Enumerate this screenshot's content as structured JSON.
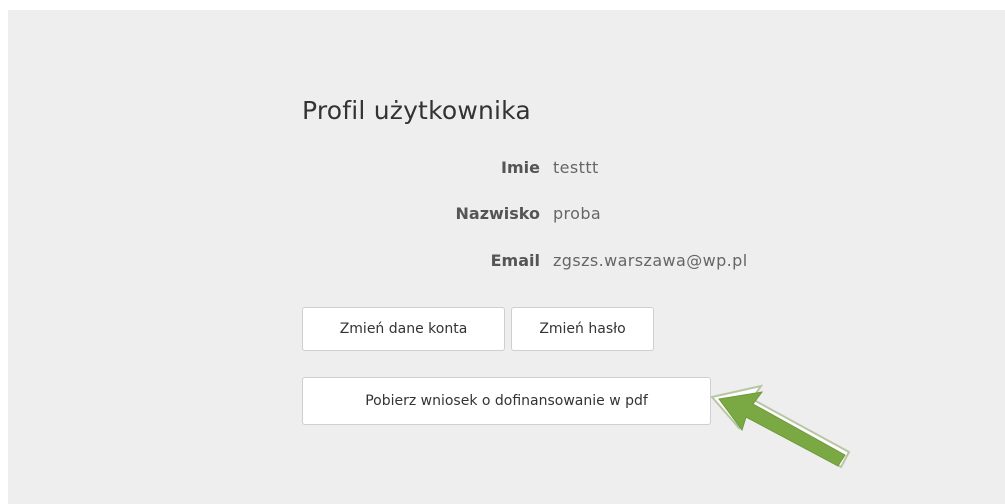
{
  "profile": {
    "title": "Profil użytkownika",
    "fields": [
      {
        "label": "Imie",
        "value": "testtt"
      },
      {
        "label": "Nazwisko",
        "value": "proba"
      },
      {
        "label": "Email",
        "value": "zgszs.warszawa@wp.pl"
      }
    ]
  },
  "buttons": {
    "change_account": "Zmień dane konta",
    "change_password": "Zmień hasło",
    "download_pdf": "Pobierz wniosek o dofinansowanie w pdf"
  },
  "annotation": {
    "arrow_icon": "arrow-pointer-icon",
    "arrow_color": "#7aa843",
    "arrow_outline": "#ffffff"
  },
  "colors": {
    "panel_bg": "#eeeeee",
    "page_bg": "#ffffff"
  }
}
